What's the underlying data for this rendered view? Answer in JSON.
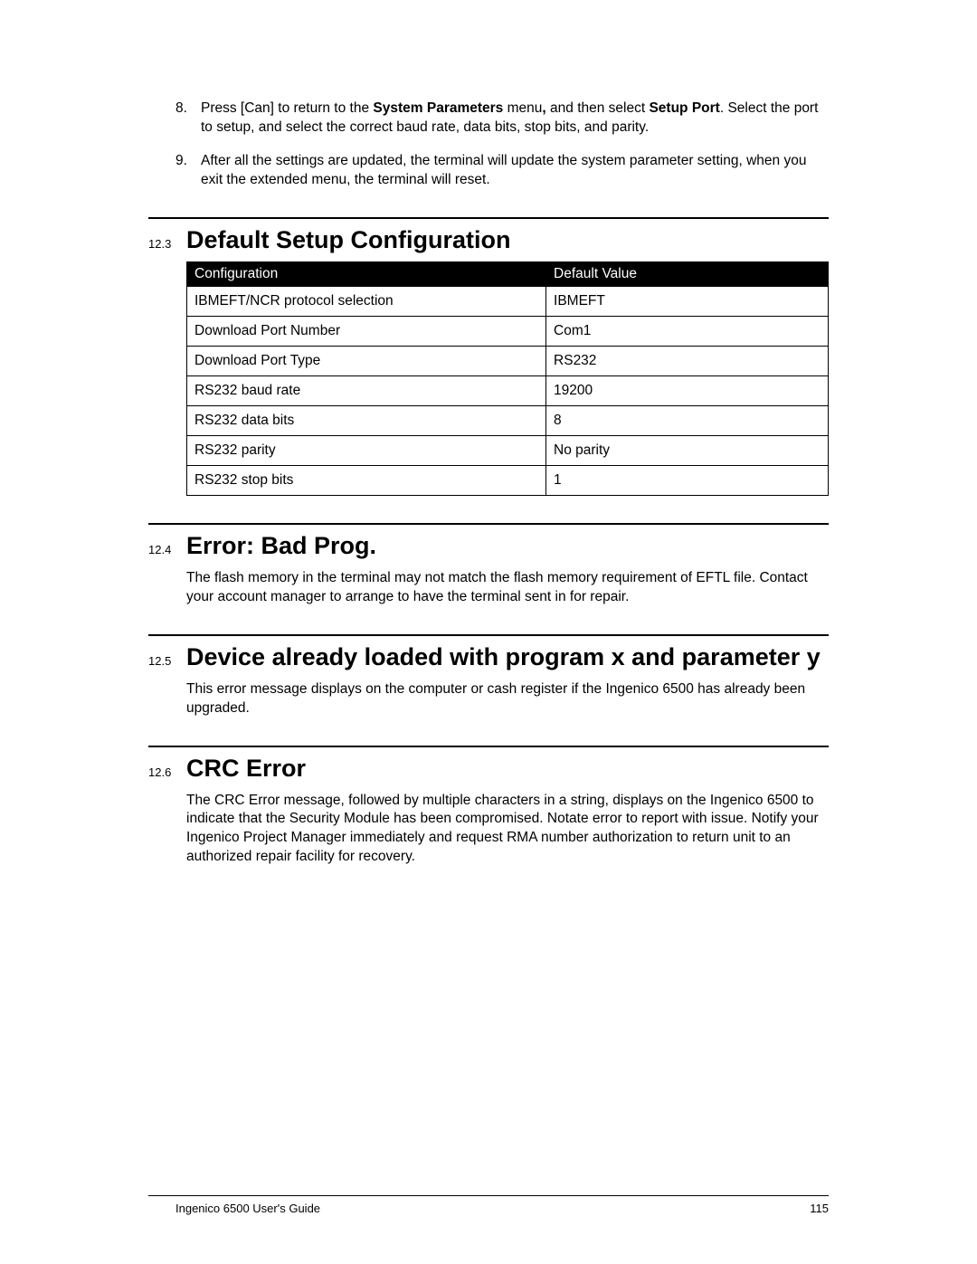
{
  "ordered_items": [
    {
      "num": "8.",
      "prefix": "Press [Can] to return to the ",
      "bold1": "System Parameters",
      "mid": " menu",
      "bold_comma": ",",
      "mid2": " and then select ",
      "bold2": "Setup Port",
      "suffix": ". Select the port to setup, and select the correct baud rate, data bits, stop bits, and parity."
    },
    {
      "num": "9.",
      "plain": "After all the settings are updated, the terminal will update the system parameter setting, when you exit the extended menu, the terminal will reset."
    }
  ],
  "sections": {
    "s123": {
      "num": "12.3",
      "title": "Default Setup Configuration"
    },
    "s124": {
      "num": "12.4",
      "title": "Error: Bad Prog.",
      "body": "The flash memory in the terminal may not match the flash memory requirement of EFTL file. Contact your account manager to arrange to have the terminal sent in for repair."
    },
    "s125": {
      "num": "12.5",
      "title": "Device already loaded with program x and parameter y",
      "body": "This error message displays on the computer or cash register if the Ingenico 6500 has already been upgraded."
    },
    "s126": {
      "num": "12.6",
      "title": "CRC Error",
      "body": "The CRC Error message, followed by multiple characters in a string, displays on the Ingenico 6500 to indicate that the Security Module has been compromised. Notate error to report with issue. Notify your Ingenico Project Manager immediately and request RMA number authorization to return unit to an authorized repair facility for recovery."
    }
  },
  "table": {
    "head": {
      "c1": "Configuration",
      "c2": "Default Value"
    },
    "rows": [
      {
        "c1": "IBMEFT/NCR protocol selection",
        "c2": "IBMEFT"
      },
      {
        "c1": "Download Port Number",
        "c2": "Com1"
      },
      {
        "c1": "Download Port Type",
        "c2": "RS232"
      },
      {
        "c1": "RS232 baud rate",
        "c2": "19200"
      },
      {
        "c1": "RS232 data bits",
        "c2": "8"
      },
      {
        "c1": "RS232 parity",
        "c2": "No parity"
      },
      {
        "c1": "RS232 stop bits",
        "c2": "1"
      }
    ]
  },
  "footer": {
    "left": "Ingenico 6500 User's Guide",
    "right": "115"
  }
}
